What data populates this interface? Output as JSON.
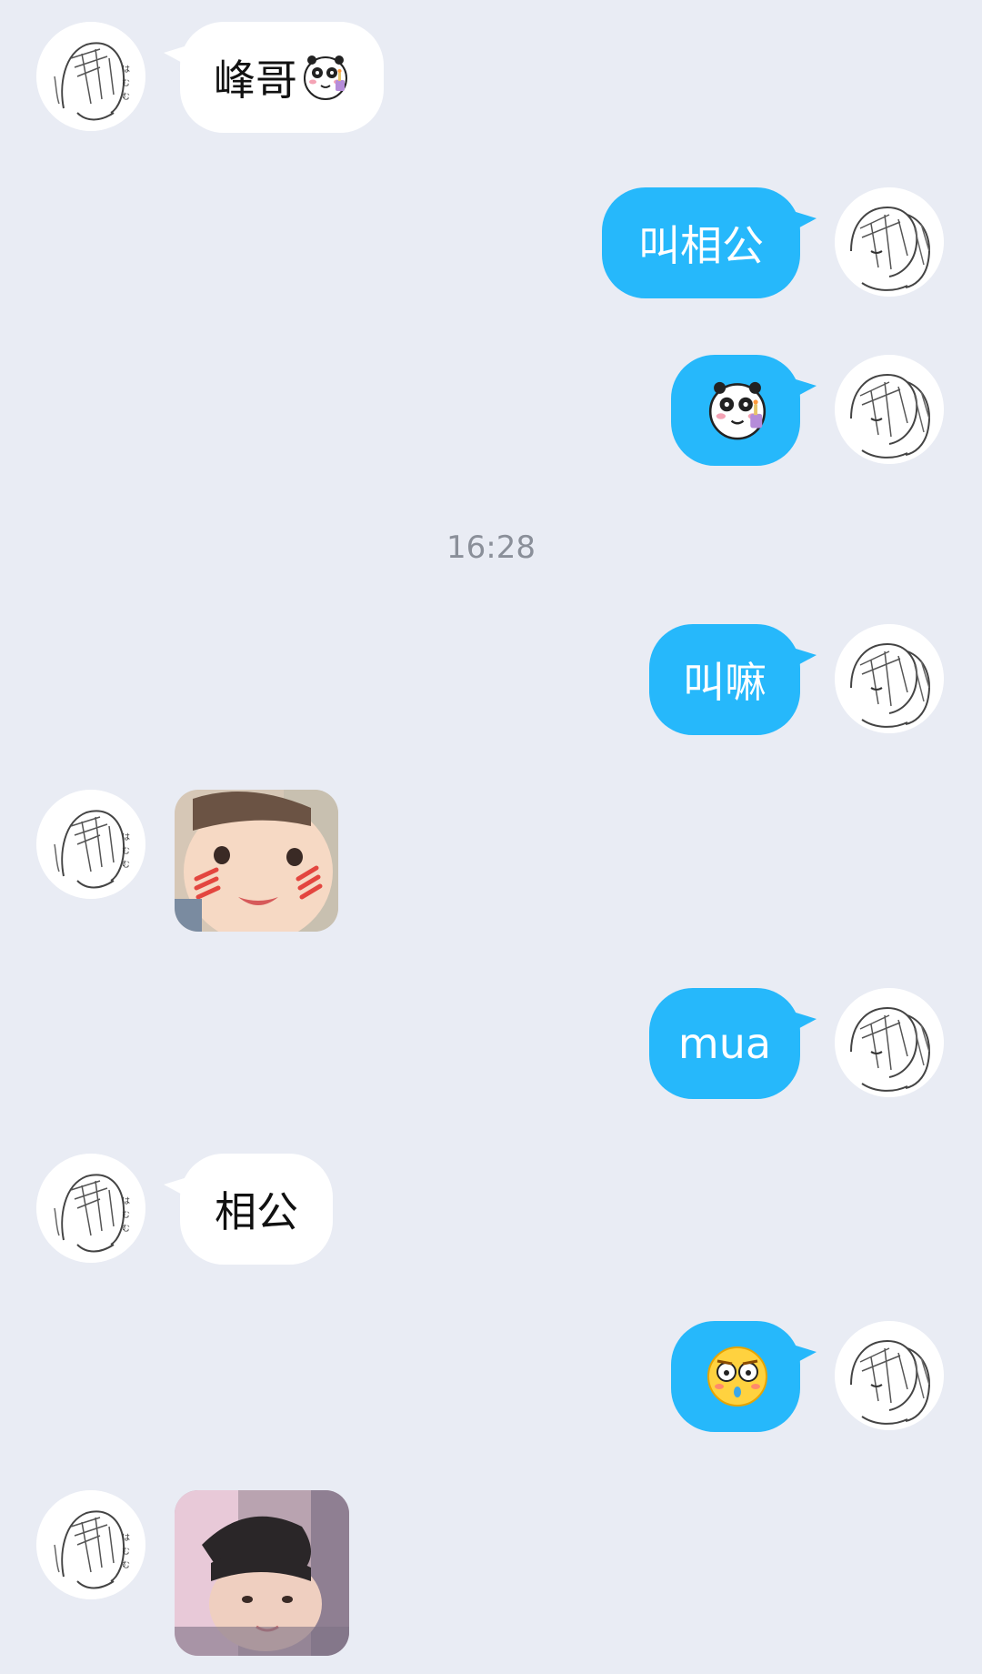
{
  "timestamp": "16:28",
  "messages": [
    {
      "side": "in",
      "text": "峰哥",
      "emoji": "panda-sticker-icon"
    },
    {
      "side": "out",
      "text": "叫相公"
    },
    {
      "side": "out",
      "emoji": "panda-sticker-icon"
    },
    {
      "side": "out",
      "text": "叫嘛"
    },
    {
      "side": "in",
      "image": "baby-blush-photo"
    },
    {
      "side": "out",
      "text": "mua"
    },
    {
      "side": "in",
      "text": "相公"
    },
    {
      "side": "out",
      "emoji": "shocked-face-icon"
    },
    {
      "side": "in",
      "image": "baby-photo"
    }
  ],
  "colors": {
    "background": "#e9ecf4",
    "outgoing_bubble": "#26b8fb",
    "incoming_bubble": "#ffffff",
    "timestamp_text": "#8a8f99"
  }
}
